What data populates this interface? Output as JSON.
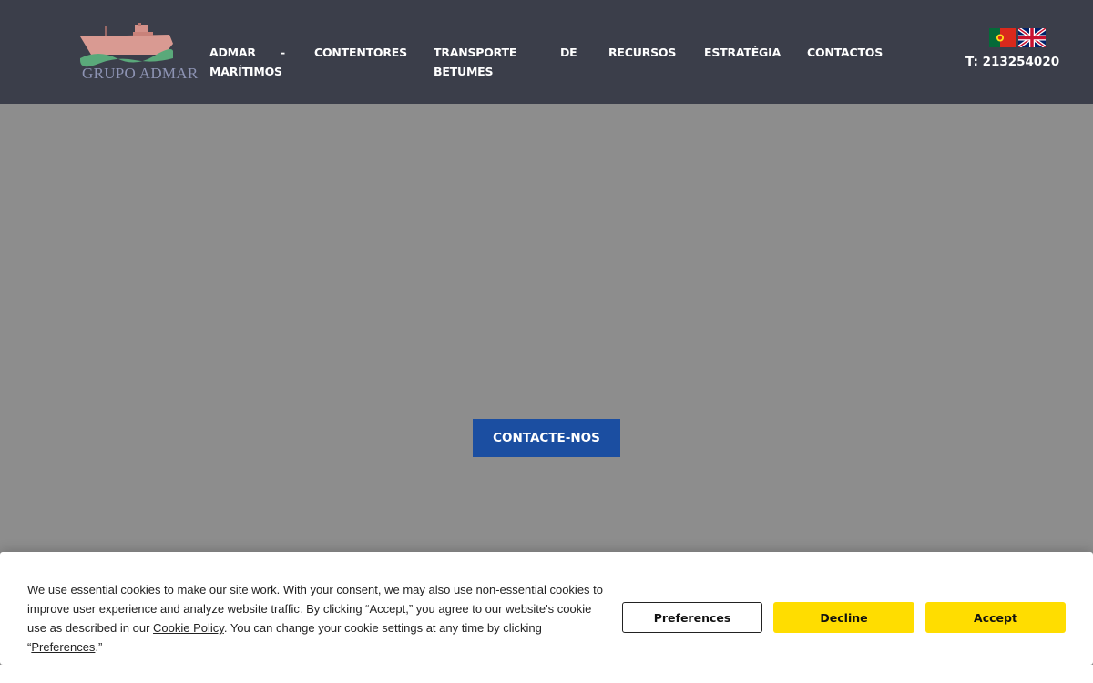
{
  "brand": {
    "logo_text": "GRUPO ADMAR"
  },
  "nav": {
    "item1": {
      "line1a": "ADMAR",
      "line1b": "-",
      "line2": "MARÍTIMOS"
    },
    "item2": {
      "label": "CONTENTORES"
    },
    "item3": {
      "line1a": "TRANSPORTE",
      "line1b": "DE",
      "line2": "BETUMES"
    },
    "item4": {
      "label": "RECURSOS"
    },
    "item5": {
      "label": "ESTRATÉGIA"
    },
    "item6": {
      "label": "CONTACTOS"
    }
  },
  "languages": [
    {
      "name": "pt-flag-icon"
    },
    {
      "name": "uk-flag-icon"
    }
  ],
  "phone": "T: 213254020",
  "hero": {
    "cta_label": "CONTACTE-NOS"
  },
  "cookie_banner": {
    "text_part1": "We use essential cookies to make our site work. With your consent, we may also use non-essential cookies to improve user experience and analyze website traffic. By clicking “Accept,” you agree to our website's cookie use as described in our ",
    "cookie_policy_link": "Cookie Policy",
    "text_part2": ". You can change your cookie settings at any time by clicking “",
    "preferences_link": "Preferences",
    "text_part3": ".”",
    "buttons": {
      "preferences": "Preferences",
      "decline": "Decline",
      "accept": "Accept"
    }
  },
  "colors": {
    "header_bg": "#3b3e4a",
    "hero_bg": "#8d8d8d",
    "cta_bg": "#1b4ea1",
    "cookie_button_yellow": "#ffdd00"
  }
}
